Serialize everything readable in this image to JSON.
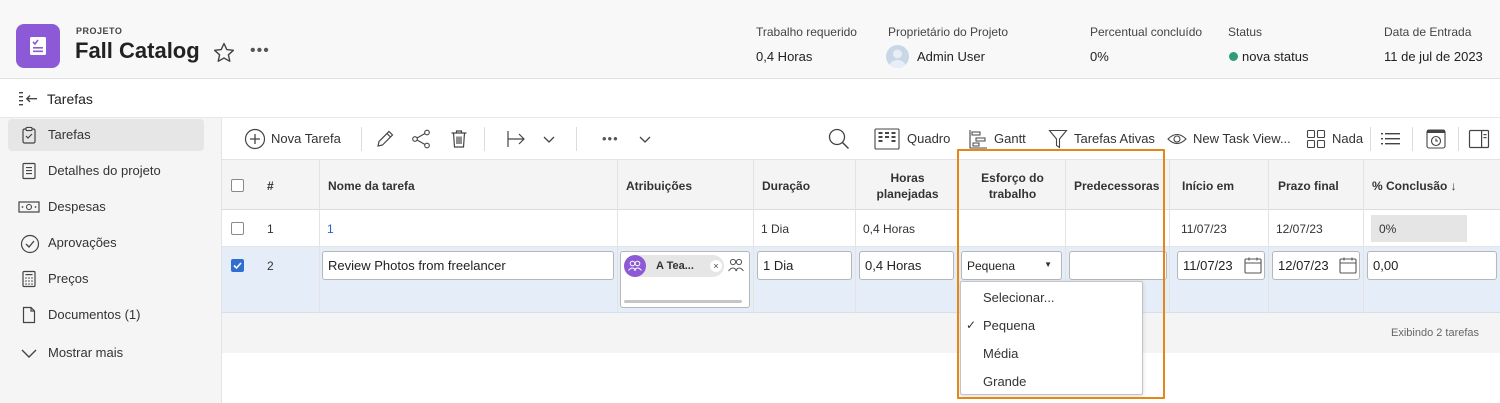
{
  "header": {
    "project_label": "PROJETO",
    "project_title": "Fall Catalog",
    "meta": [
      {
        "label": "Trabalho requerido",
        "value": "0,4 Horas"
      },
      {
        "label": "Proprietário do Projeto",
        "value": "Admin User"
      },
      {
        "label": "Percentual concluído",
        "value": "0%"
      },
      {
        "label": "Status",
        "value": "nova status"
      },
      {
        "label": "Data de Entrada",
        "value": "11 de jul de 2023"
      }
    ],
    "status_color": "#2d9d78",
    "brand_color": "#8c5ad6"
  },
  "breadcrumb": {
    "title": "Tarefas"
  },
  "sidebar": {
    "items": [
      {
        "label": "Tarefas",
        "icon": "clipboard-check-icon"
      },
      {
        "label": "Detalhes do projeto",
        "icon": "document-icon"
      },
      {
        "label": "Despesas",
        "icon": "money-icon"
      },
      {
        "label": "Aprovações",
        "icon": "check-circle-icon"
      },
      {
        "label": "Preços",
        "icon": "calculator-icon"
      },
      {
        "label": "Documentos (1)",
        "icon": "file-icon"
      },
      {
        "label": "Mostrar mais",
        "icon": "chevron-down-icon"
      }
    ]
  },
  "toolbar": {
    "new_task": "Nova Tarefa",
    "board": "Quadro",
    "gantt": "Gantt",
    "filter": "Tarefas Ativas",
    "view": "New Task View...",
    "grouping": "Nada",
    "more": "•••"
  },
  "table": {
    "columns": {
      "num": "#",
      "name": "Nome da tarefa",
      "assign": "Atribuições",
      "duration": "Duração",
      "hours_1": "Horas",
      "hours_2": "planejadas",
      "effort_1": "Esforço do",
      "effort_2": "trabalho",
      "pred": "Predecessoras",
      "start": "Início em",
      "due": "Prazo final",
      "pct": "% Conclusão ↓"
    },
    "rows": [
      {
        "num": "1",
        "name": "1",
        "assign": "",
        "duration": "1 Dia",
        "hours": "0,4 Horas",
        "effort": "",
        "pred": "",
        "start": "11/07/23",
        "due": "12/07/23",
        "pct": "0%"
      },
      {
        "num": "2",
        "name": "Review Photos from freelancer",
        "assign": "A Tea...",
        "duration": "1 Dia",
        "hours": "0,4 Horas",
        "effort": "Pequena",
        "pred": "",
        "start": "11/07/23",
        "due": "12/07/23",
        "pct": "0,00"
      }
    ],
    "footer": "Exibindo 2 tarefas"
  },
  "dropdown": {
    "options": [
      "Selecionar...",
      "Pequena",
      "Média",
      "Grande"
    ],
    "selected": "Pequena"
  },
  "highlight_color": "#e68619"
}
